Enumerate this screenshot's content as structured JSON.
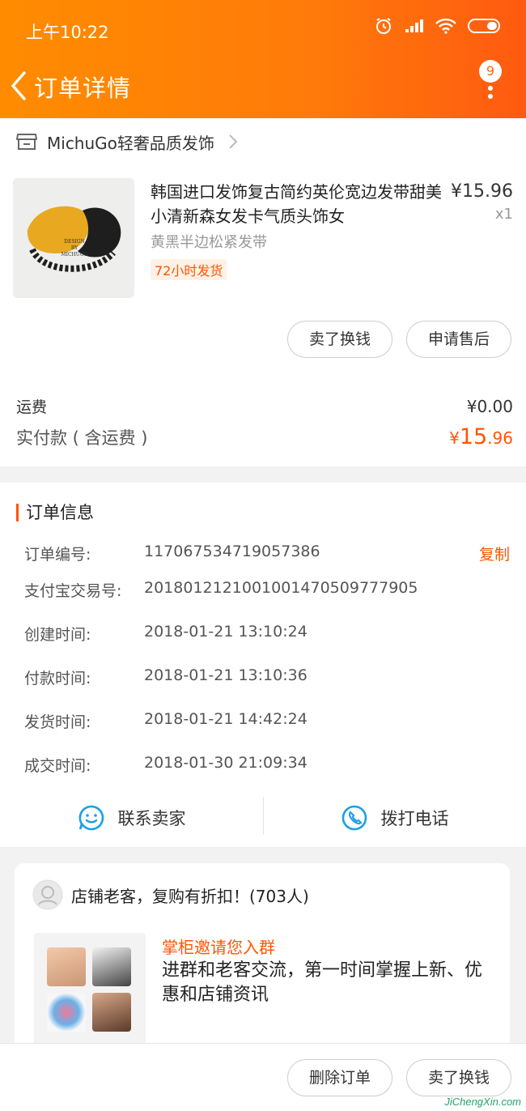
{
  "status_bar": {
    "time": "上午10:22"
  },
  "header": {
    "title": "订单详情",
    "badge_count": "9"
  },
  "shop": {
    "name": "MichuGo轻奢品质发饰"
  },
  "product": {
    "title": "韩国进口发饰复古简约英伦宽边发带甜美小清新森女发卡气质头饰女",
    "price": "¥15.96",
    "quantity": "x1",
    "sku": "黄黑半边松紧发带",
    "tag": "72小时发货",
    "image_text": [
      "DESIGN",
      "BY",
      "MICHUGO"
    ]
  },
  "actions": {
    "sell_exchange": "卖了换钱",
    "after_sale": "申请售后"
  },
  "fees": {
    "shipping_label": "运费",
    "shipping_value": "¥0.00",
    "paid_label": "实付款 ( 含运费 )",
    "paid_currency": "¥",
    "paid_int": "15",
    "paid_dec": ".96"
  },
  "order_info": {
    "title": "订单信息",
    "copy_label": "复制",
    "rows": [
      {
        "label": "订单编号:",
        "value": "117067534719057386"
      },
      {
        "label": "支付宝交易号:",
        "value": "2018012121001001470509777905"
      },
      {
        "label": "创建时间:",
        "value": "2018-01-21 13:10:24"
      },
      {
        "label": "付款时间:",
        "value": "2018-01-21 13:10:36"
      },
      {
        "label": "发货时间:",
        "value": "2018-01-21 14:42:24"
      },
      {
        "label": "成交时间:",
        "value": "2018-01-30 21:09:34"
      }
    ]
  },
  "contact": {
    "seller": "联系卖家",
    "phone": "拨打电话"
  },
  "group": {
    "title": "店铺老客，复购有折扣！(703人)",
    "invite": "掌柜邀请您入群",
    "desc": "进群和老客交流，第一时间掌握上新、优惠和店铺资讯"
  },
  "footer": {
    "delete_order": "删除订单",
    "sell_exchange": "卖了换钱"
  },
  "watermark": "JiChengXin.com",
  "colors": {
    "accent": "#ff5500",
    "header_start": "#ff8c00",
    "header_end": "#ff5a10",
    "contact_icon": "#1aa0e6"
  }
}
